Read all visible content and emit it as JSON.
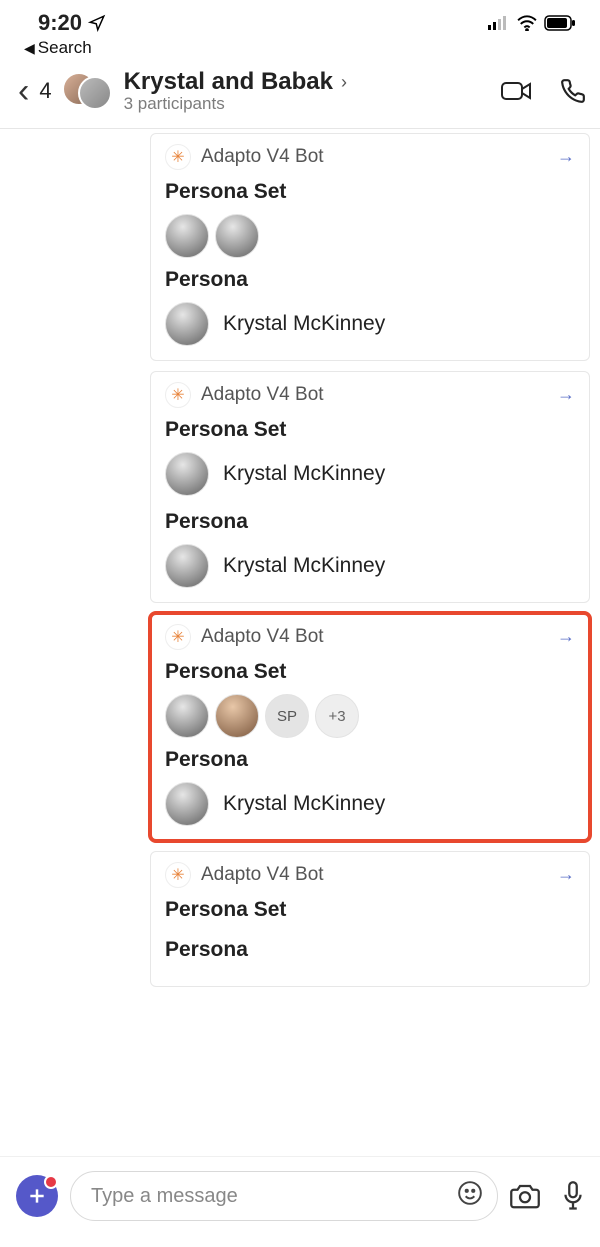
{
  "status": {
    "time": "9:20",
    "back_label": "Search"
  },
  "header": {
    "unread_count": "4",
    "title": "Krystal and Babak",
    "subtitle": "3 participants"
  },
  "bot_name": "Adapto V4 Bot",
  "labels": {
    "persona_set": "Persona Set",
    "persona": "Persona"
  },
  "cards": [
    {
      "persona_name": "Krystal McKinney",
      "set_type": "avatars_only",
      "highlighted": false
    },
    {
      "persona_name": "Krystal McKinney",
      "set_name": "Krystal McKinney",
      "set_type": "named",
      "highlighted": false
    },
    {
      "persona_name": "Krystal McKinney",
      "set_type": "facepile",
      "extra_initials": "SP",
      "overflow_label": "+3",
      "highlighted": true
    },
    {
      "set_type": "empty",
      "highlighted": false
    }
  ],
  "compose": {
    "placeholder": "Type a message"
  }
}
